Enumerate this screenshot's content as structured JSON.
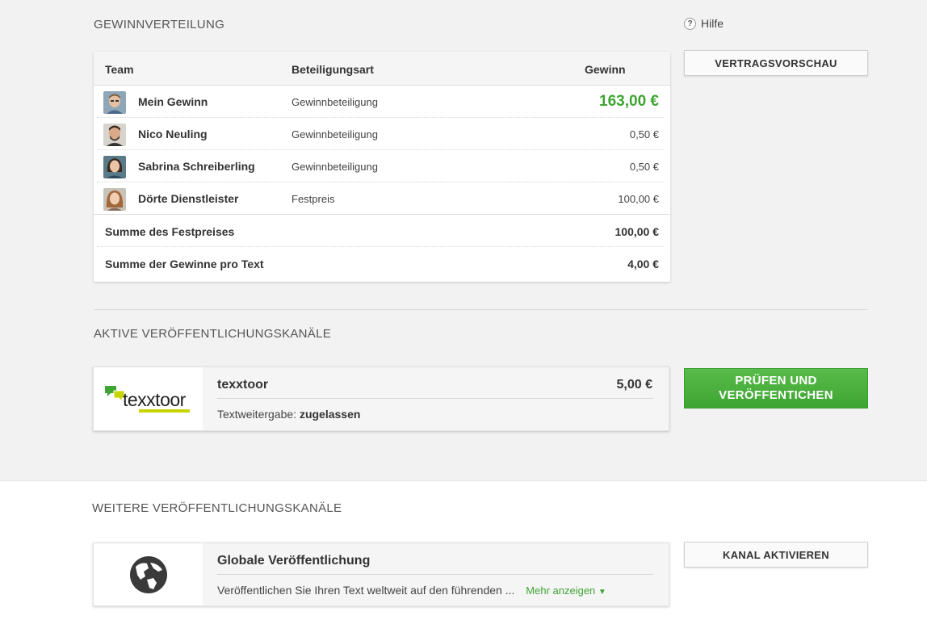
{
  "profit": {
    "section_title": "GEWINNVERTEILUNG",
    "help_label": "Hilfe",
    "preview_button": "VERTRAGSVORSCHAU",
    "headers": {
      "team": "Team",
      "type": "Beteiligungsart",
      "profit": "Gewinn"
    },
    "rows": [
      {
        "name": "Mein Gewinn",
        "type": "Gewinnbeteiligung",
        "amount": "163,00 €"
      },
      {
        "name": "Nico Neuling",
        "type": "Gewinnbeteiligung",
        "amount": "0,50 €"
      },
      {
        "name": "Sabrina Schreiberling",
        "type": "Gewinnbeteiligung",
        "amount": "0,50 €"
      },
      {
        "name": "Dörte Dienstleister",
        "type": "Festpreis",
        "amount": "100,00 €"
      }
    ],
    "sums": [
      {
        "label": "Summe des Festpreises",
        "amount": "100,00 €"
      },
      {
        "label": "Summe der Gewinne pro Text",
        "amount": "4,00 €"
      }
    ],
    "accent_color": "#3ea532"
  },
  "active": {
    "section_title": "AKTIVE VERÖFFENTLICHUNGSKANÄLE",
    "channel": {
      "logo_text": "texxtoor",
      "title": "texxtoor",
      "price": "5,00 €",
      "info_label": "Textweitergabe:",
      "info_value": "zugelassen"
    },
    "publish_button": "PRÜFEN UND VERÖFFENTICHEN"
  },
  "more": {
    "section_title": "WEITERE VERÖFFENTLICHUNGSKANÄLE",
    "channel": {
      "icon": "globe-icon",
      "title": "Globale Veröffentlichung",
      "description": "Veröffentlichen Sie Ihren Text weltweit auf den führenden ...",
      "more_link": "Mehr anzeigen"
    },
    "activate_button": "KANAL AKTIVIEREN"
  }
}
